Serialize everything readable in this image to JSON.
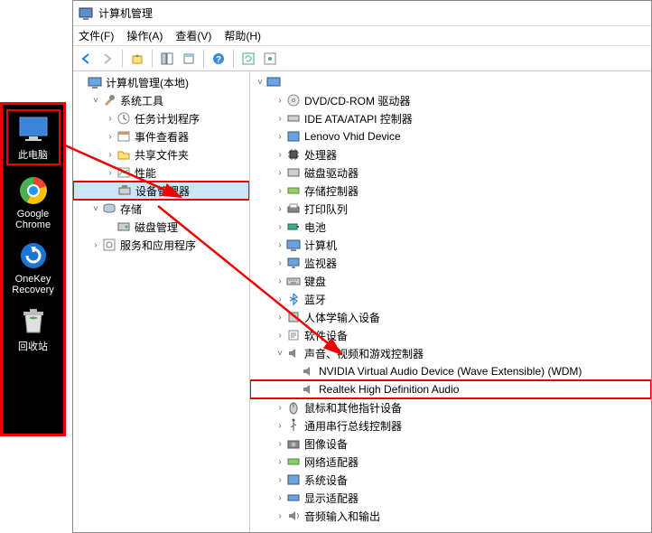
{
  "desktop": {
    "this_pc": "此电脑",
    "chrome": "Google\nChrome",
    "onekey": "OneKey\nRecovery",
    "recycle": "回收站"
  },
  "window": {
    "title": "计算机管理",
    "menus": {
      "file": "文件(F)",
      "action": "操作(A)",
      "view": "查看(V)",
      "help": "帮助(H)"
    }
  },
  "left_tree": {
    "root": "计算机管理(本地)",
    "sys_tools": "系统工具",
    "task_sched": "任务计划程序",
    "event_viewer": "事件查看器",
    "shared": "共享文件夹",
    "perf": "性能",
    "dev_mgr": "设备管理器",
    "storage": "存储",
    "disk_mgmt": "磁盘管理",
    "services": "服务和应用程序"
  },
  "right_tree": {
    "root": "",
    "dvd": "DVD/CD-ROM 驱动器",
    "ide": "IDE ATA/ATAPI 控制器",
    "lenovo": "Lenovo Vhid Device",
    "cpu": "处理器",
    "disk_drive": "磁盘驱动器",
    "storage_ctrl": "存储控制器",
    "print_queue": "打印队列",
    "battery": "电池",
    "computer": "计算机",
    "monitor": "监视器",
    "keyboard": "键盘",
    "bluetooth": "蓝牙",
    "hid": "人体学输入设备",
    "software_dev": "软件设备",
    "sound_ctrl": "声音、视频和游戏控制器",
    "nvidia_audio": "NVIDIA Virtual Audio Device (Wave Extensible) (WDM)",
    "realtek": "Realtek High Definition Audio",
    "mouse": "鼠标和其他指针设备",
    "usb_ctrl": "通用串行总线控制器",
    "imaging": "图像设备",
    "network": "网络适配器",
    "sys_dev": "系统设备",
    "display": "显示适配器",
    "audio_io": "音频输入和输出"
  }
}
